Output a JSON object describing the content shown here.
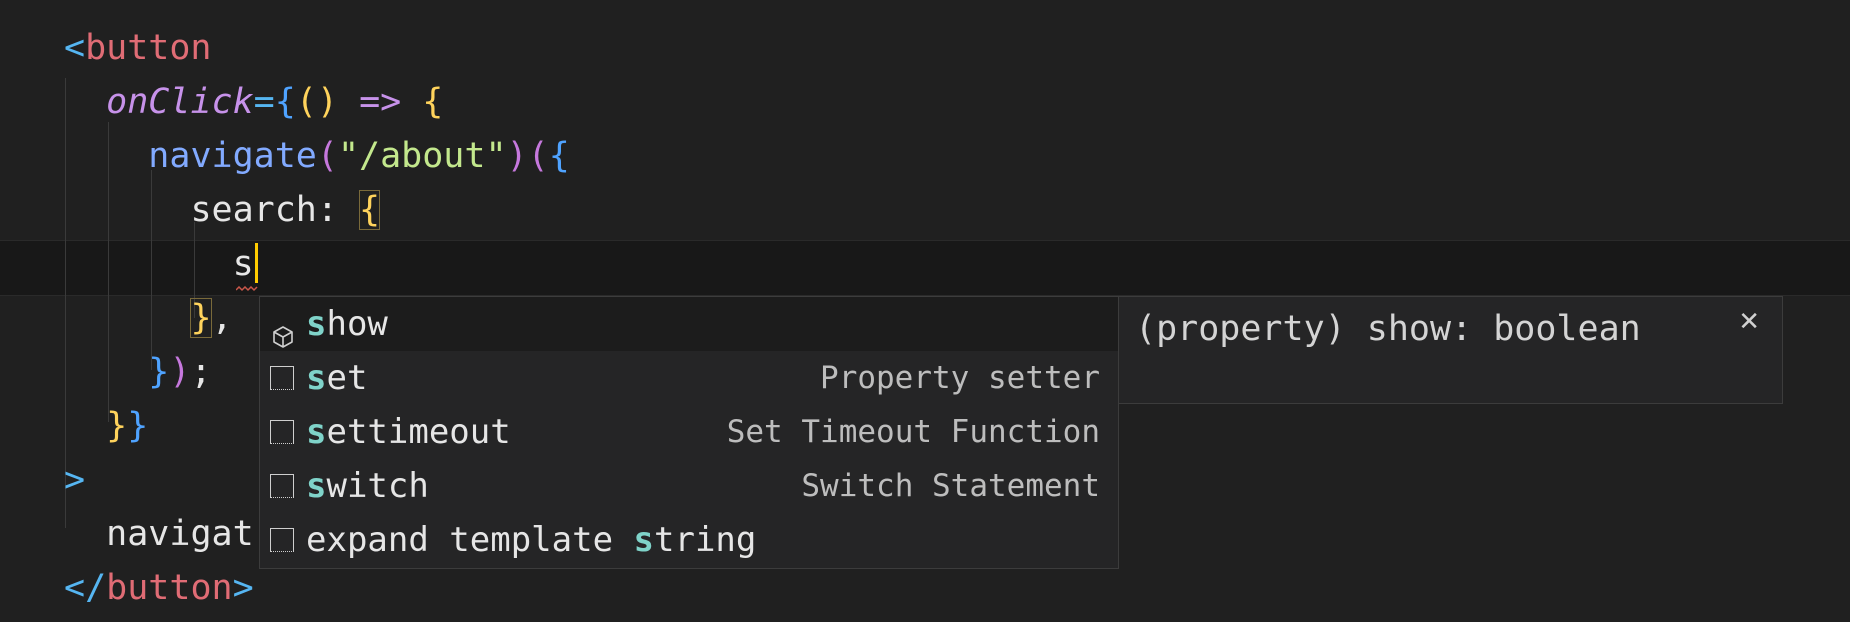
{
  "editor": {
    "lines": [
      {
        "id": "l1",
        "segments": [
          {
            "t": "<",
            "c": "punct"
          },
          {
            "t": "button",
            "c": "tag"
          }
        ]
      },
      {
        "id": "l2",
        "segments": [
          {
            "t": "  "
          },
          {
            "t": "onClick",
            "c": "attr"
          },
          {
            "t": "=",
            "c": "punct"
          },
          {
            "t": "{",
            "c": "brace-b"
          },
          {
            "t": "(",
            "c": "brace-y"
          },
          {
            "t": ")",
            "c": "brace-y"
          },
          {
            "t": " ",
            "c": "plain"
          },
          {
            "t": "=>",
            "c": "op"
          },
          {
            "t": " ",
            "c": "plain"
          },
          {
            "t": "{",
            "c": "brace-y"
          }
        ]
      },
      {
        "id": "l3",
        "segments": [
          {
            "t": "    "
          },
          {
            "t": "navigate",
            "c": "fn"
          },
          {
            "t": "(",
            "c": "brace-p"
          },
          {
            "t": "\"/about\"",
            "c": "str"
          },
          {
            "t": ")",
            "c": "brace-p"
          },
          {
            "t": "(",
            "c": "brace-p"
          },
          {
            "t": "{",
            "c": "brace-b"
          }
        ]
      },
      {
        "id": "l4",
        "segments": [
          {
            "t": "      "
          },
          {
            "t": "search",
            "c": "plain"
          },
          {
            "t": ": ",
            "c": "plain"
          },
          {
            "t": "{",
            "c": "brace-y boxed"
          }
        ]
      },
      {
        "id": "l5",
        "segments": [
          {
            "t": "        "
          },
          {
            "t": "s",
            "c": "plain"
          }
        ]
      },
      {
        "id": "l6",
        "segments": [
          {
            "t": "      "
          },
          {
            "t": "}",
            "c": "brace-y boxed"
          },
          {
            "t": ",",
            "c": "plain"
          }
        ]
      },
      {
        "id": "l7",
        "segments": [
          {
            "t": "    "
          },
          {
            "t": "}",
            "c": "brace-b"
          },
          {
            "t": ")",
            "c": "brace-p"
          },
          {
            "t": ";",
            "c": "plain"
          }
        ]
      },
      {
        "id": "l8",
        "segments": [
          {
            "t": "  "
          },
          {
            "t": "}",
            "c": "brace-y"
          },
          {
            "t": "}",
            "c": "brace-b"
          }
        ]
      },
      {
        "id": "l9",
        "segments": [
          {
            "t": ">",
            "c": "punct"
          }
        ]
      },
      {
        "id": "l10",
        "segments": [
          {
            "t": "  "
          },
          {
            "t": "navigat",
            "c": "plain"
          }
        ]
      },
      {
        "id": "l11",
        "segments": [
          {
            "t": "</",
            "c": "punct"
          },
          {
            "t": "button",
            "c": "tag"
          },
          {
            "t": ">",
            "c": "punct"
          }
        ]
      }
    ]
  },
  "suggest": {
    "items": [
      {
        "pre": "",
        "hl": "s",
        "post": "how",
        "detail": "",
        "icon": "property-icon"
      },
      {
        "pre": "",
        "hl": "s",
        "post": "et",
        "detail": "Property setter",
        "icon": "snippet-icon"
      },
      {
        "pre": "",
        "hl": "s",
        "post": "ettimeout",
        "detail": "Set Timeout Function",
        "icon": "snippet-icon"
      },
      {
        "pre": "",
        "hl": "s",
        "post": "witch",
        "detail": "Switch Statement",
        "icon": "snippet-icon"
      },
      {
        "pre": "expand template ",
        "hl": "s",
        "post": "tring",
        "detail": "",
        "icon": "snippet-icon"
      }
    ]
  },
  "details": {
    "text": "(property) show: boolean",
    "close_glyph": "✕"
  }
}
